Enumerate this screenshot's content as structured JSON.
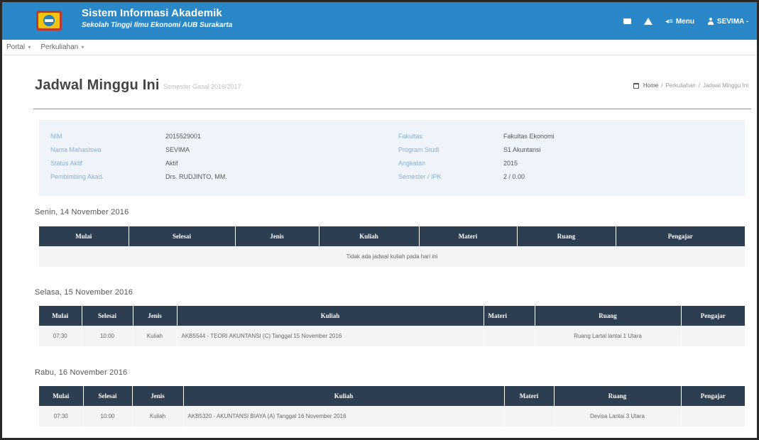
{
  "header": {
    "title": "Sistem Informasi Akademik",
    "subtitle": "Sekolah Tinggi Ilmu Ekonomi AUB Surakarta",
    "menu_label": "Menu",
    "user_label": "SEVIMA -",
    "colors": {
      "navbar": "#2b88c8",
      "table_header": "#2d3e50",
      "accent_line": "#5cb85c"
    }
  },
  "submenu": {
    "portal": "Portal",
    "perkuliahan": "Perkuliahan"
  },
  "page": {
    "title": "Jadwal Minggu Ini",
    "subtitle": "Semester Gasal 2016/2017",
    "breadcrumb": [
      "Home",
      "Perkuliahan",
      "Jadwal Minggu Ini"
    ]
  },
  "student": {
    "labels": {
      "nim": "NIM",
      "nama": "Nama Mahasiswa",
      "status": "Status Aktif",
      "pembimbing": "Pembimbing Akad.",
      "fakultas": "Fakultas",
      "prodi": "Program Studi",
      "angkatan": "Angkatan",
      "semester": "Semester / IPK"
    },
    "values": {
      "nim": "2015529001",
      "nama": "SEVIMA",
      "status": "Aktif",
      "pembimbing": "Drs. RUDJINTO, MM.",
      "fakultas": "Fakultas Ekonomi",
      "prodi": "S1 Akuntansi",
      "angkatan": "2015",
      "semester": "2 / 0.00"
    }
  },
  "columns": {
    "mulai": "Mulai",
    "selesai": "Selesai",
    "jenis": "Jenis",
    "kuliah": "Kuliah",
    "materi": "Materi",
    "ruang": "Ruang",
    "pengajar": "Pengajar"
  },
  "days": [
    {
      "title": "Senin, 14 November 2016",
      "empty": "Tidak ada jadwal kuliah pada hari ini"
    },
    {
      "title": "Selasa, 15 November 2016",
      "row": {
        "mulai": "07:30",
        "selesai": "10:00",
        "jenis": "Kuliah",
        "kuliah": "AKB5544 - TEORI AKUNTANSI (C) Tanggal 15 November 2016",
        "materi": "",
        "ruang": "Ruang Lartal lantai 1 Utara",
        "pengajar": ""
      }
    },
    {
      "title": "Rabu, 16 November 2016",
      "row": {
        "mulai": "07:30",
        "selesai": "10:00",
        "jenis": "Kuliah",
        "kuliah": "AKB5320 - AKUNTANSI BIAYA (A) Tanggal 16 November 2016",
        "materi": "",
        "ruang": "Devisa Lantai 3 Utara",
        "pengajar": ""
      }
    }
  ]
}
